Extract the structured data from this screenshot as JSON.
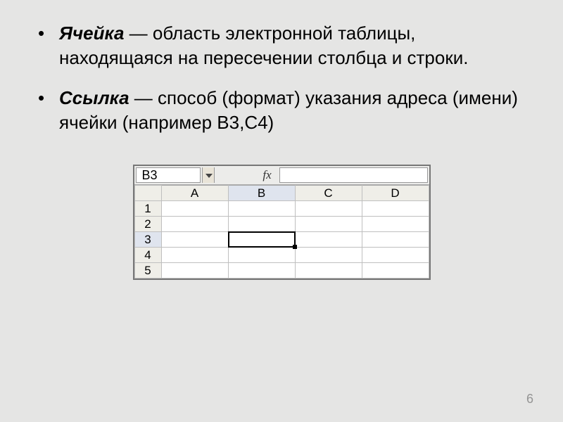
{
  "bullets": [
    {
      "term": "Ячейка",
      "text": " — область электронной таблицы, находящаяся на пересечении столбца и строки."
    },
    {
      "term": "Ссылка",
      "text": " — способ (формат) указания адреса (имени) ячейки (например В3,С4)"
    }
  ],
  "spreadsheet": {
    "namebox": "B3",
    "fx_label": "fx",
    "formula_value": "",
    "columns": [
      "A",
      "B",
      "C",
      "D"
    ],
    "rows": [
      "1",
      "2",
      "3",
      "4",
      "5"
    ],
    "active_col": "B",
    "active_row": "3",
    "selected_cell": "B3"
  },
  "page_number": "6"
}
